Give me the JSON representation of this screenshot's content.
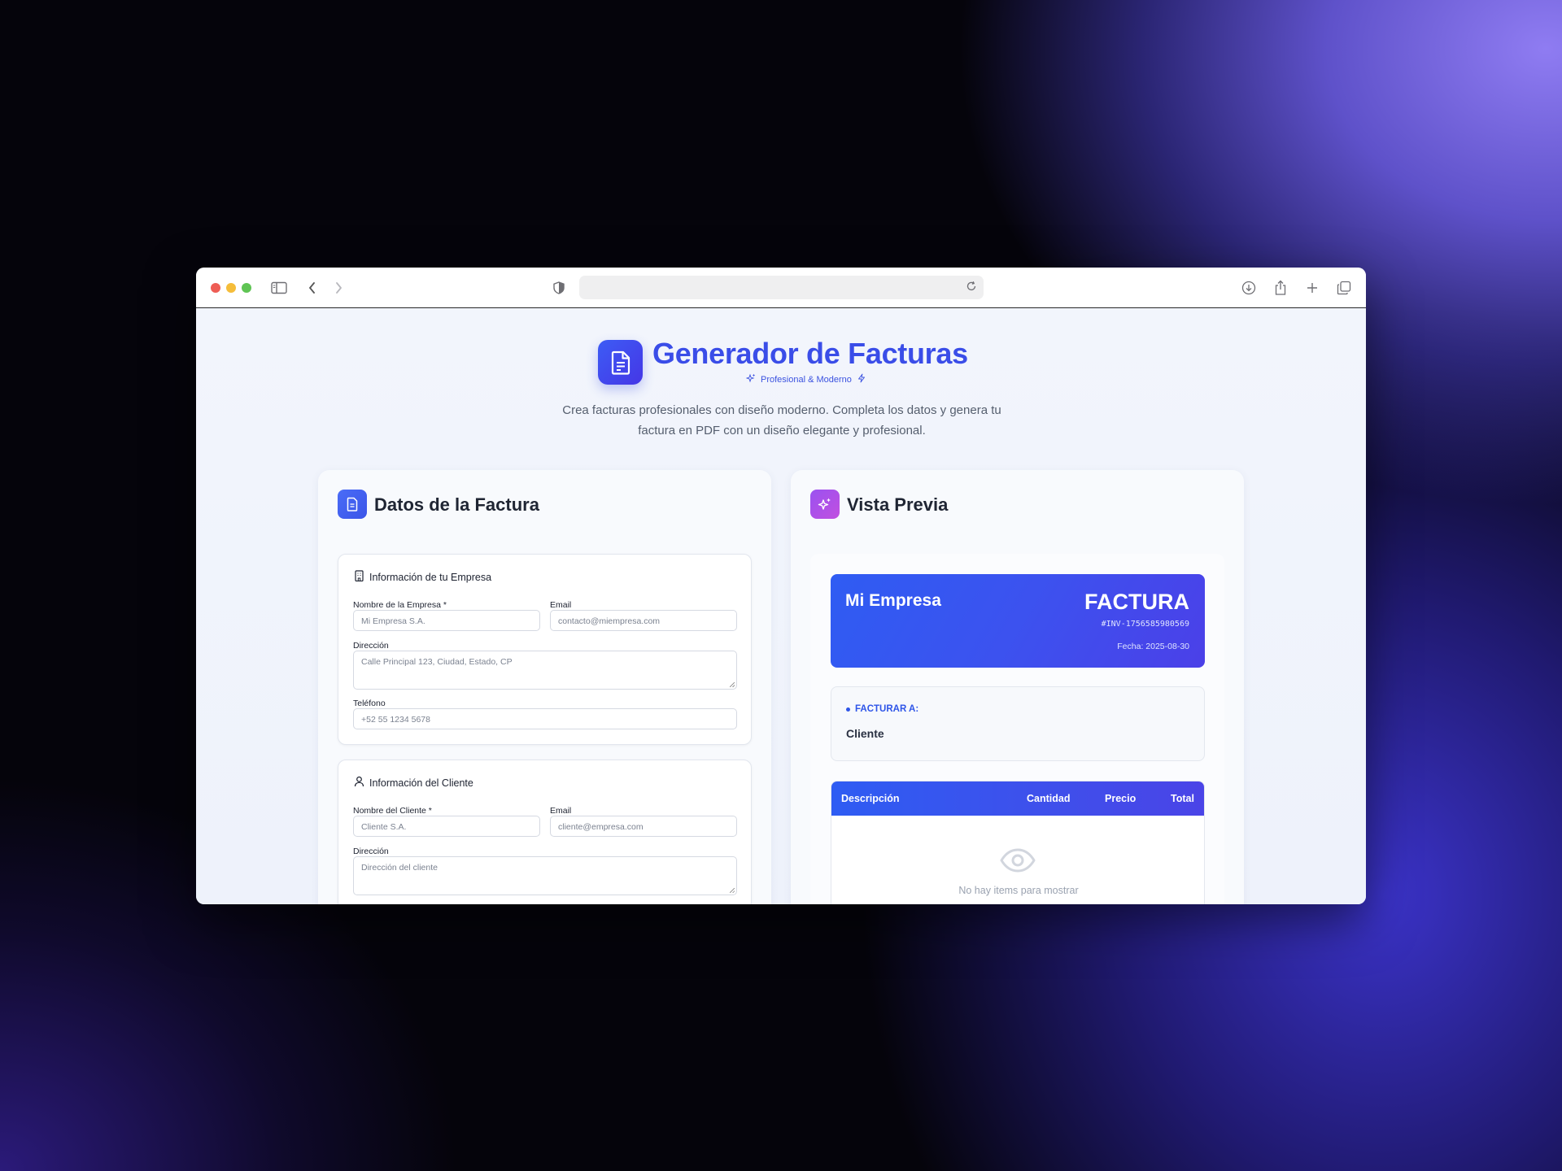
{
  "browser": {
    "url": ""
  },
  "hero": {
    "title": "Generador de Facturas",
    "tagline": "Profesional & Moderno",
    "description": "Crea facturas profesionales con diseño moderno. Completa los datos y genera tu factura en PDF con un diseño elegante y profesional."
  },
  "form_panel": {
    "title": "Datos de la Factura",
    "company_section": {
      "heading": "Información de tu Empresa",
      "name_label": "Nombre de la Empresa *",
      "name_placeholder": "Mi Empresa S.A.",
      "email_label": "Email",
      "email_placeholder": "contacto@miempresa.com",
      "address_label": "Dirección",
      "address_placeholder": "Calle Principal 123, Ciudad, Estado, CP",
      "phone_label": "Teléfono",
      "phone_placeholder": "+52 55 1234 5678"
    },
    "client_section": {
      "heading": "Información del Cliente",
      "name_label": "Nombre del Cliente *",
      "name_placeholder": "Cliente S.A.",
      "email_label": "Email",
      "email_placeholder": "cliente@empresa.com",
      "address_label": "Dirección",
      "address_placeholder": "Dirección del cliente"
    }
  },
  "preview_panel": {
    "title": "Vista Previa",
    "invoice": {
      "company": "Mi Empresa",
      "word": "FACTURA",
      "number": "#INV-1756585980569",
      "date": "Fecha: 2025-08-30",
      "bill_to_label": "FACTURAR A:",
      "client": "Cliente",
      "columns": [
        "Descripción",
        "Cantidad",
        "Precio",
        "Total"
      ],
      "empty_message": "No hay items para mostrar"
    }
  },
  "colors": {
    "accent": "#3a4de8",
    "preview_accent": "#9a52f0"
  }
}
